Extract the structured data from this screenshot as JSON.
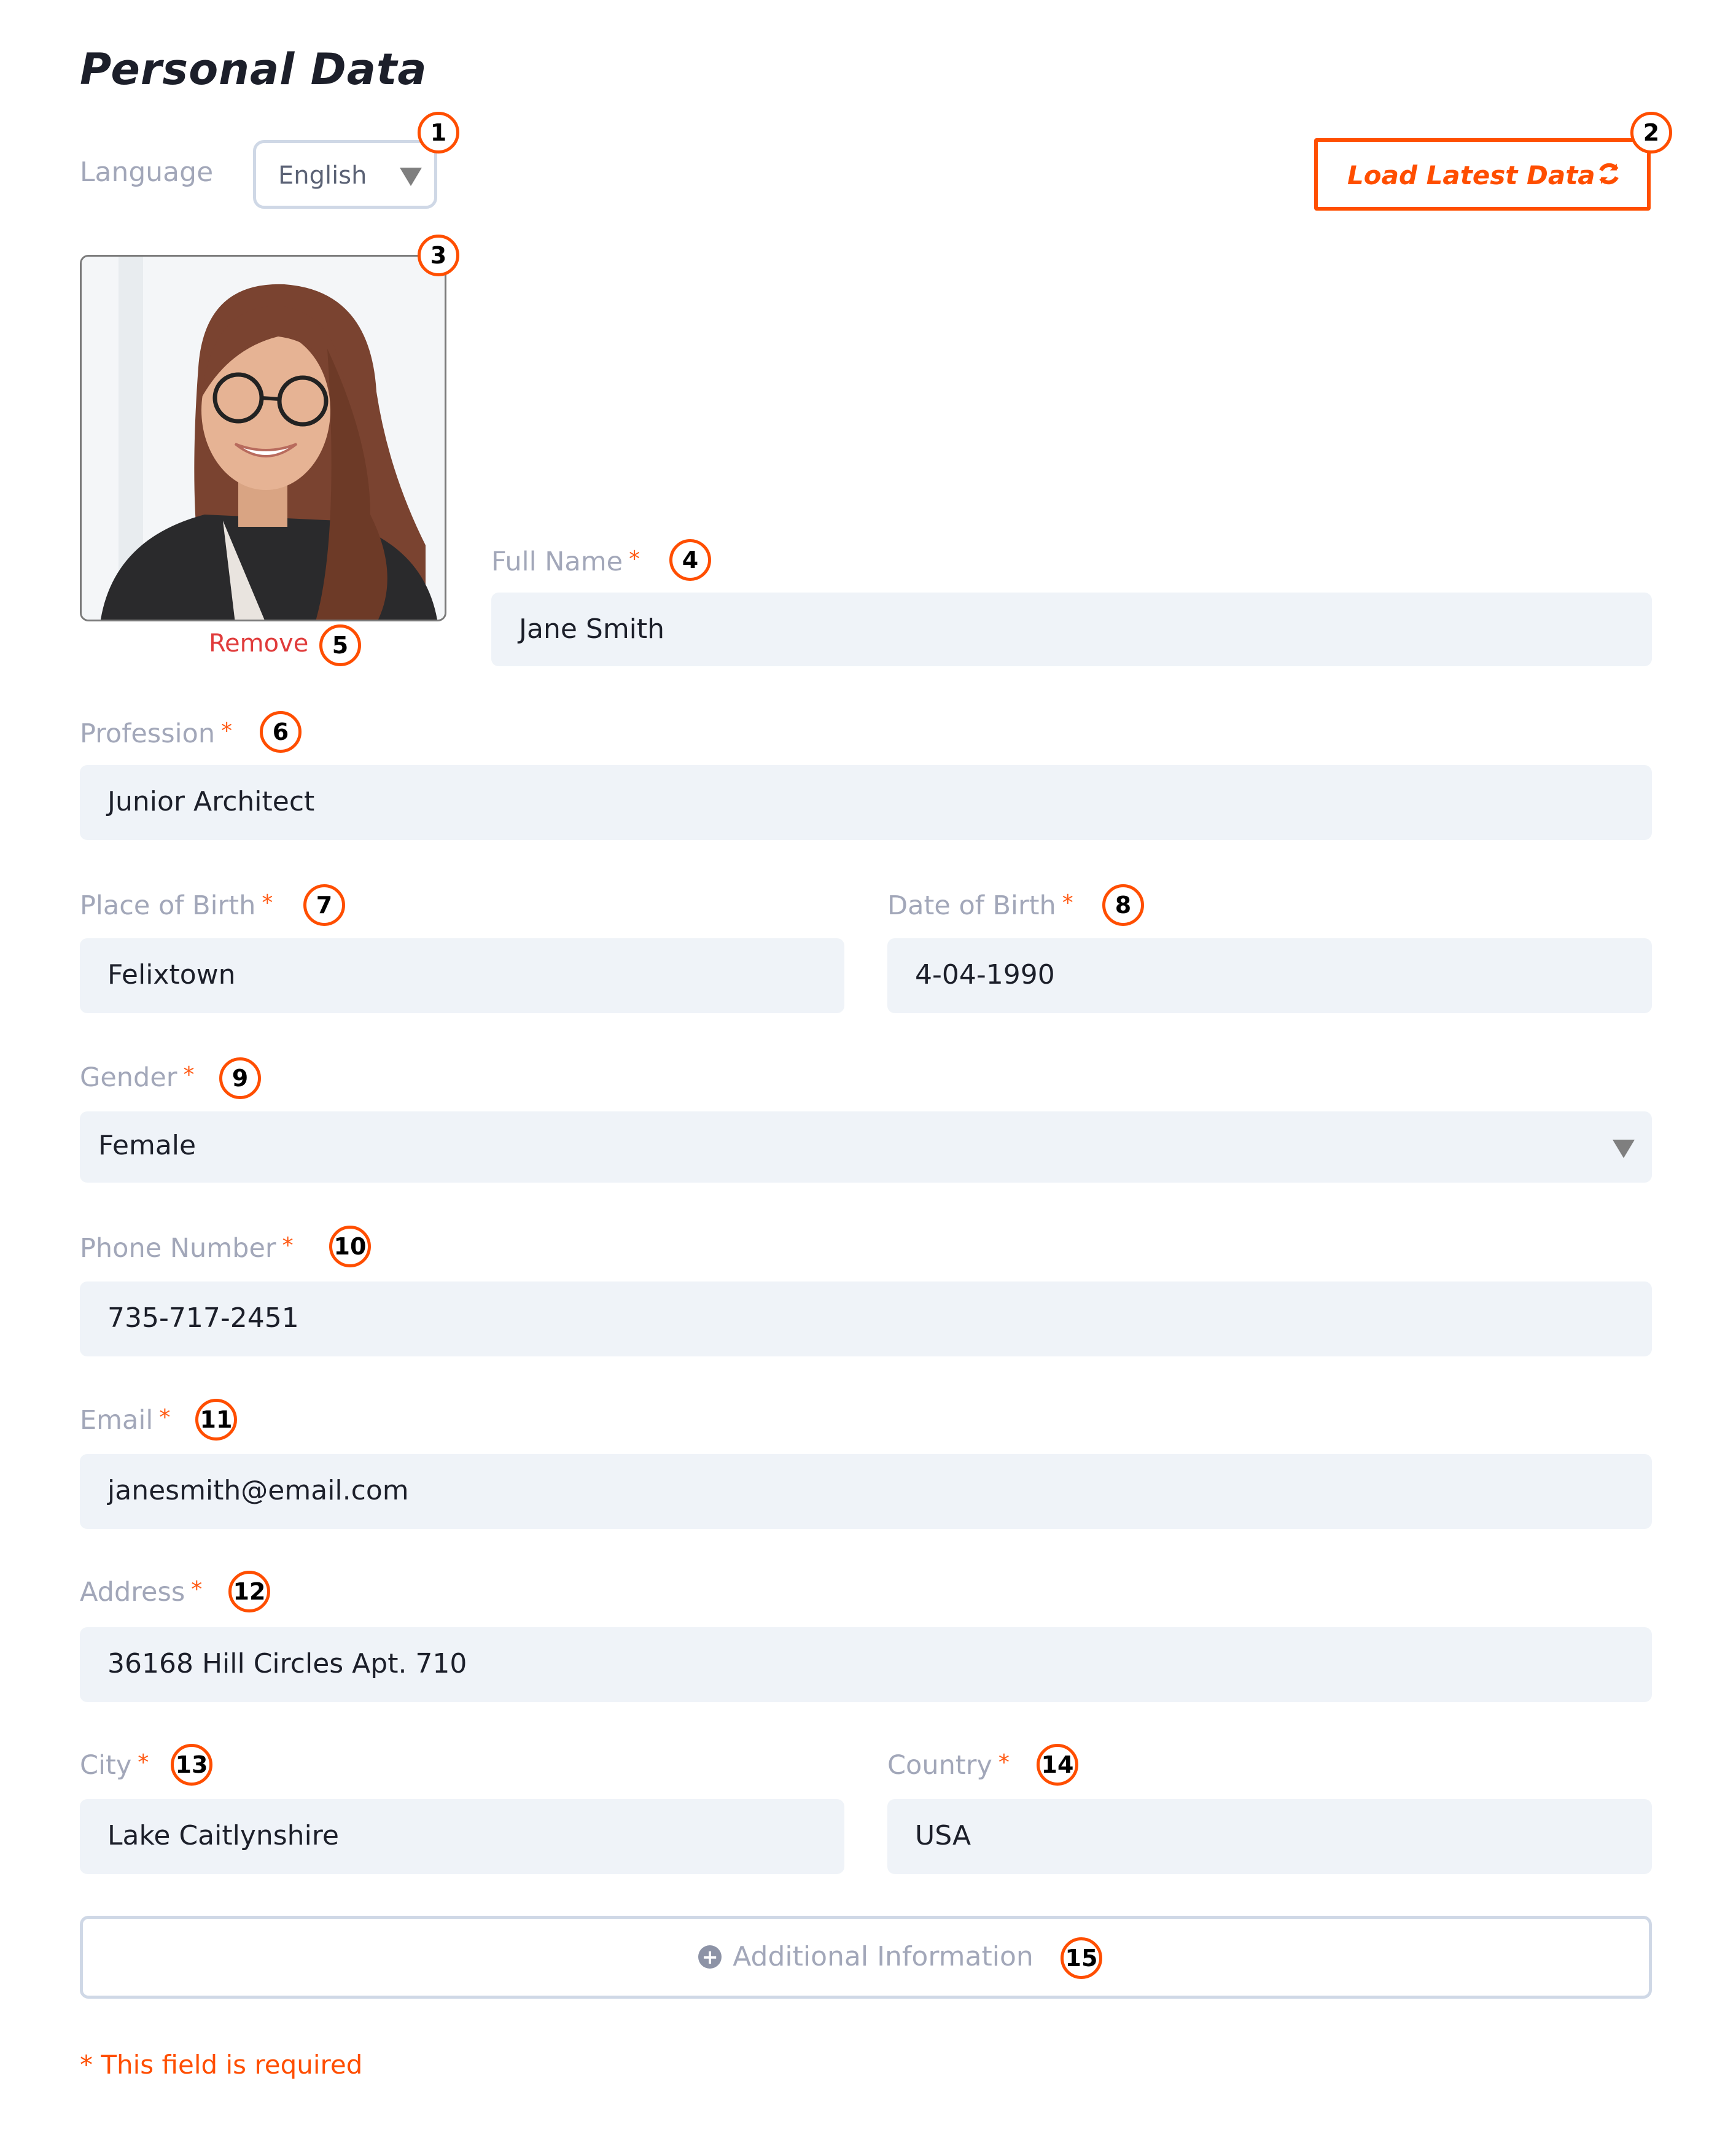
{
  "page": {
    "title": "Personal Data",
    "accent_color": "#ff4e00",
    "required_marker": "*",
    "required_note": "* This field is required"
  },
  "language": {
    "label": "Language",
    "selected": "English",
    "badge": "1"
  },
  "load_button": {
    "label": "Load Latest Data",
    "icon": "refresh-icon",
    "badge": "2"
  },
  "photo": {
    "alt": "Profile photo of a smiling woman with glasses and long brown hair",
    "badge": "3",
    "remove_label": "Remove",
    "remove_badge": "5"
  },
  "fields": {
    "full_name": {
      "label": "Full Name",
      "value": "Jane Smith",
      "badge": "4"
    },
    "profession": {
      "label": "Profession",
      "value": "Junior Architect",
      "badge": "6"
    },
    "place_of_birth": {
      "label": "Place of Birth",
      "value": "Felixtown",
      "badge": "7"
    },
    "date_of_birth": {
      "label": "Date of Birth",
      "value": "4-04-1990",
      "badge": "8"
    },
    "gender": {
      "label": "Gender",
      "value": "Female",
      "badge": "9"
    },
    "phone": {
      "label": "Phone Number",
      "value": "735-717-2451",
      "badge": "10"
    },
    "email": {
      "label": "Email",
      "value": "janesmith@email.com",
      "badge": "11"
    },
    "address": {
      "label": "Address",
      "value": "36168 Hill Circles Apt. 710",
      "badge": "12"
    },
    "city": {
      "label": "City",
      "value": "Lake Caitlynshire",
      "badge": "13"
    },
    "country": {
      "label": "Country",
      "value": "USA",
      "badge": "14"
    }
  },
  "additional_info": {
    "label": "Additional Information",
    "icon": "plus-circle-icon",
    "badge": "15"
  }
}
